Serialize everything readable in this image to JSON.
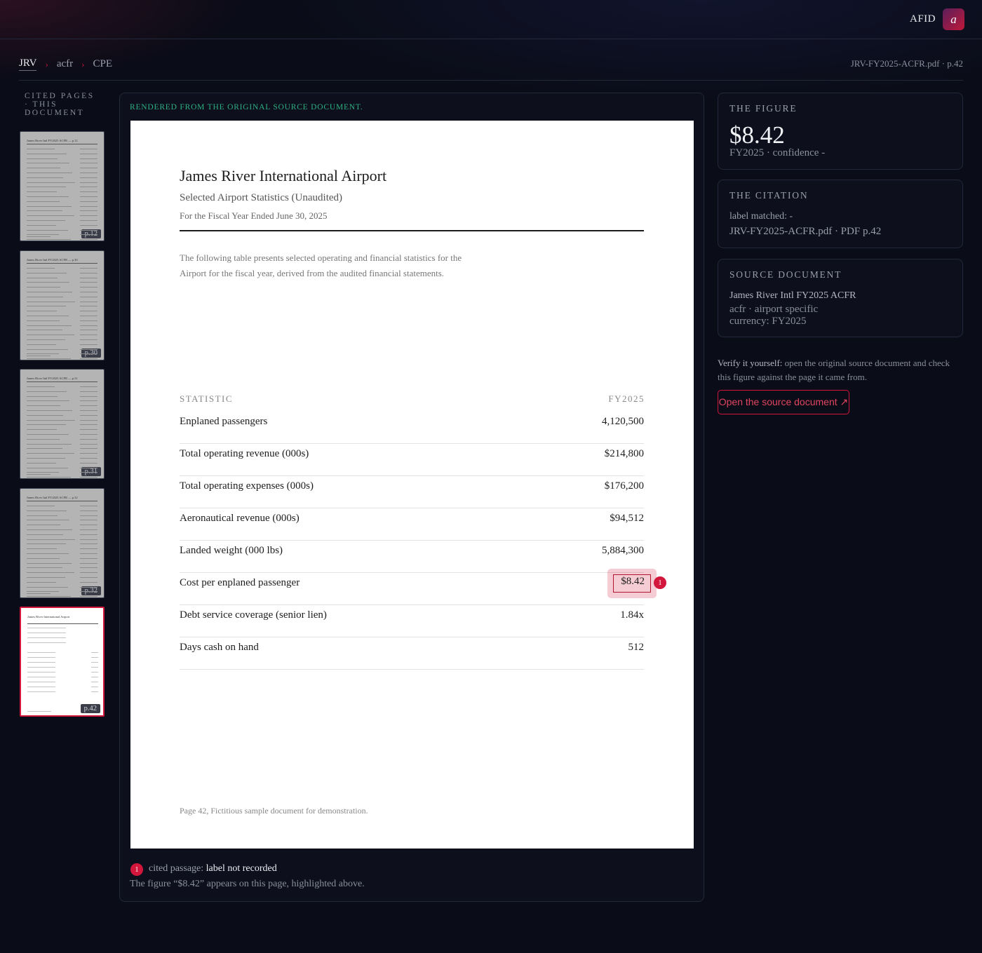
{
  "topbar": {
    "brand": "AFID",
    "avatar_letter": "a"
  },
  "breadcrumb": {
    "items": [
      "JRV",
      "acfr",
      "CPE"
    ],
    "separator": "›"
  },
  "doc_ref": "JRV-FY2025-ACFR.pdf · p.42",
  "sidebar": {
    "title": "CITED PAGES · THIS DOCUMENT",
    "thumbs": [
      {
        "label": "p.12",
        "header": "James River Intl FY2025 ACFR — p.12"
      },
      {
        "label": "p.30",
        "header": "James River Intl FY2025 ACFR — p.30"
      },
      {
        "label": "p.31",
        "header": "James River Intl FY2025 ACFR — p.31"
      },
      {
        "label": "p.32",
        "header": "James River Intl FY2025 ACFR — p.32"
      },
      {
        "label": "p.42",
        "header": "James River International Airport",
        "active": true
      }
    ]
  },
  "viewer": {
    "rendered_note": "RENDERED FROM THE ORIGINAL SOURCE DOCUMENT.",
    "page": {
      "title": "James River International Airport",
      "subtitle": "Selected Airport Statistics (Unaudited)",
      "period": "For the Fiscal Year Ended June 30, 2025",
      "intro": "The following table presents selected operating and financial statistics for the Airport for the fiscal year, derived from the audited financial statements.",
      "col_statistic": "STATISTIC",
      "col_year": "FY2025",
      "rows": [
        {
          "label": "Enplaned passengers",
          "value": "4,120,500"
        },
        {
          "label": "Total operating revenue (000s)",
          "value": "$214,800"
        },
        {
          "label": "Total operating expenses (000s)",
          "value": "$176,200"
        },
        {
          "label": "Aeronautical revenue (000s)",
          "value": "$94,512"
        },
        {
          "label": "Landed weight (000 lbs)",
          "value": "5,884,300"
        },
        {
          "label": "Cost per enplaned passenger",
          "value": "$8.42",
          "highlighted": true
        },
        {
          "label": "Debt service coverage (senior lien)",
          "value": "1.84x"
        },
        {
          "label": "Days cash on hand",
          "value": "512"
        }
      ],
      "highlight_badge": "1",
      "footer": "Page 42, Fictitious sample document for demonstration."
    },
    "cited": {
      "badge": "1",
      "prefix": "cited passage:",
      "label": "label not recorded",
      "description": "The figure “$8.42” appears on this page, highlighted above."
    }
  },
  "figure_card": {
    "title": "THE FIGURE",
    "value": "$8.42",
    "sub": "FY2025 · confidence -"
  },
  "citation_card": {
    "title": "THE CITATION",
    "label_matched": "label matched: -",
    "location": "JRV-FY2025-ACFR.pdf · PDF p.42"
  },
  "source_card": {
    "title": "SOURCE DOCUMENT",
    "name": "James River Intl FY2025 ACFR",
    "kind": "acfr · airport specific",
    "currency": "currency: FY2025"
  },
  "verify": {
    "lead": "Verify it yourself:",
    "text": "open the original source document and check this figure against the page it came from.",
    "button": "Open the source document ↗"
  },
  "colors": {
    "accent": "#d2163c",
    "note_green": "#2fb083",
    "background": "#0a0c17"
  }
}
